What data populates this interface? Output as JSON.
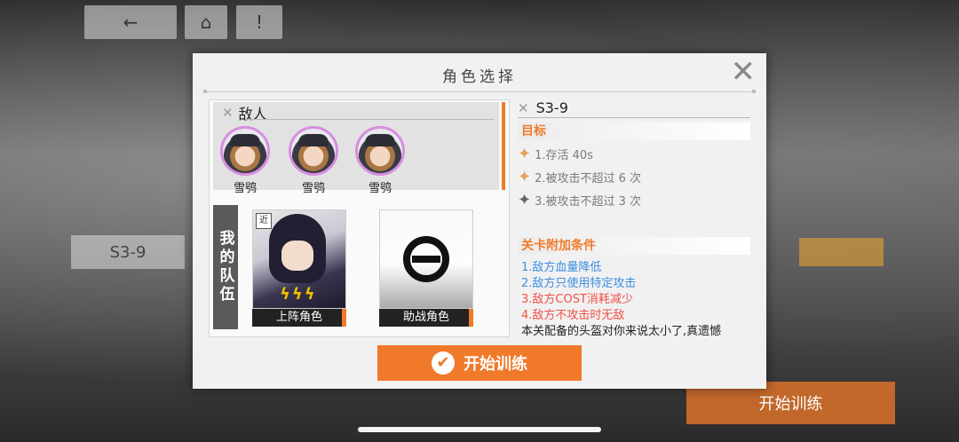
{
  "background": {
    "back_icon": "←",
    "home_icon": "⌂",
    "alert_icon": "!",
    "stage_label": "S3-9",
    "start_label": "开始训练"
  },
  "dialog": {
    "title": "角色选择",
    "close_icon": "✕"
  },
  "enemies": {
    "heading": "敌人",
    "items": [
      {
        "name": "雪鸮"
      },
      {
        "name": "雪鸮"
      },
      {
        "name": "雪鸮"
      }
    ]
  },
  "team": {
    "label": "我的队伍",
    "main_label": "上阵角色",
    "support_label": "助战角色",
    "badge": "近"
  },
  "stage": {
    "name": "S3-9",
    "objectives_heading": "目标",
    "objectives": [
      {
        "text": "1.存活 40s",
        "star": "orange"
      },
      {
        "text": "2.被攻击不超过 6 次",
        "star": "orange"
      },
      {
        "text": "3.被攻击不超过 3 次",
        "star": "gray"
      }
    ],
    "conditions_heading": "关卡附加条件",
    "conditions": [
      {
        "text": "1.敌方血量降低",
        "color": "blue"
      },
      {
        "text": "2.敌方只使用特定攻击",
        "color": "blue"
      },
      {
        "text": "3.敌方COST消耗减少",
        "color": "red"
      },
      {
        "text": "4.敌方不攻击时无敌",
        "color": "red"
      }
    ],
    "note": "本关配备的头盔对你来说太小了,真遗憾"
  },
  "start_button": {
    "label": "开始训练",
    "icon": "✔"
  },
  "colors": {
    "accent": "#f07a2a",
    "blue": "#3d8fe0",
    "red": "#f0504a"
  }
}
